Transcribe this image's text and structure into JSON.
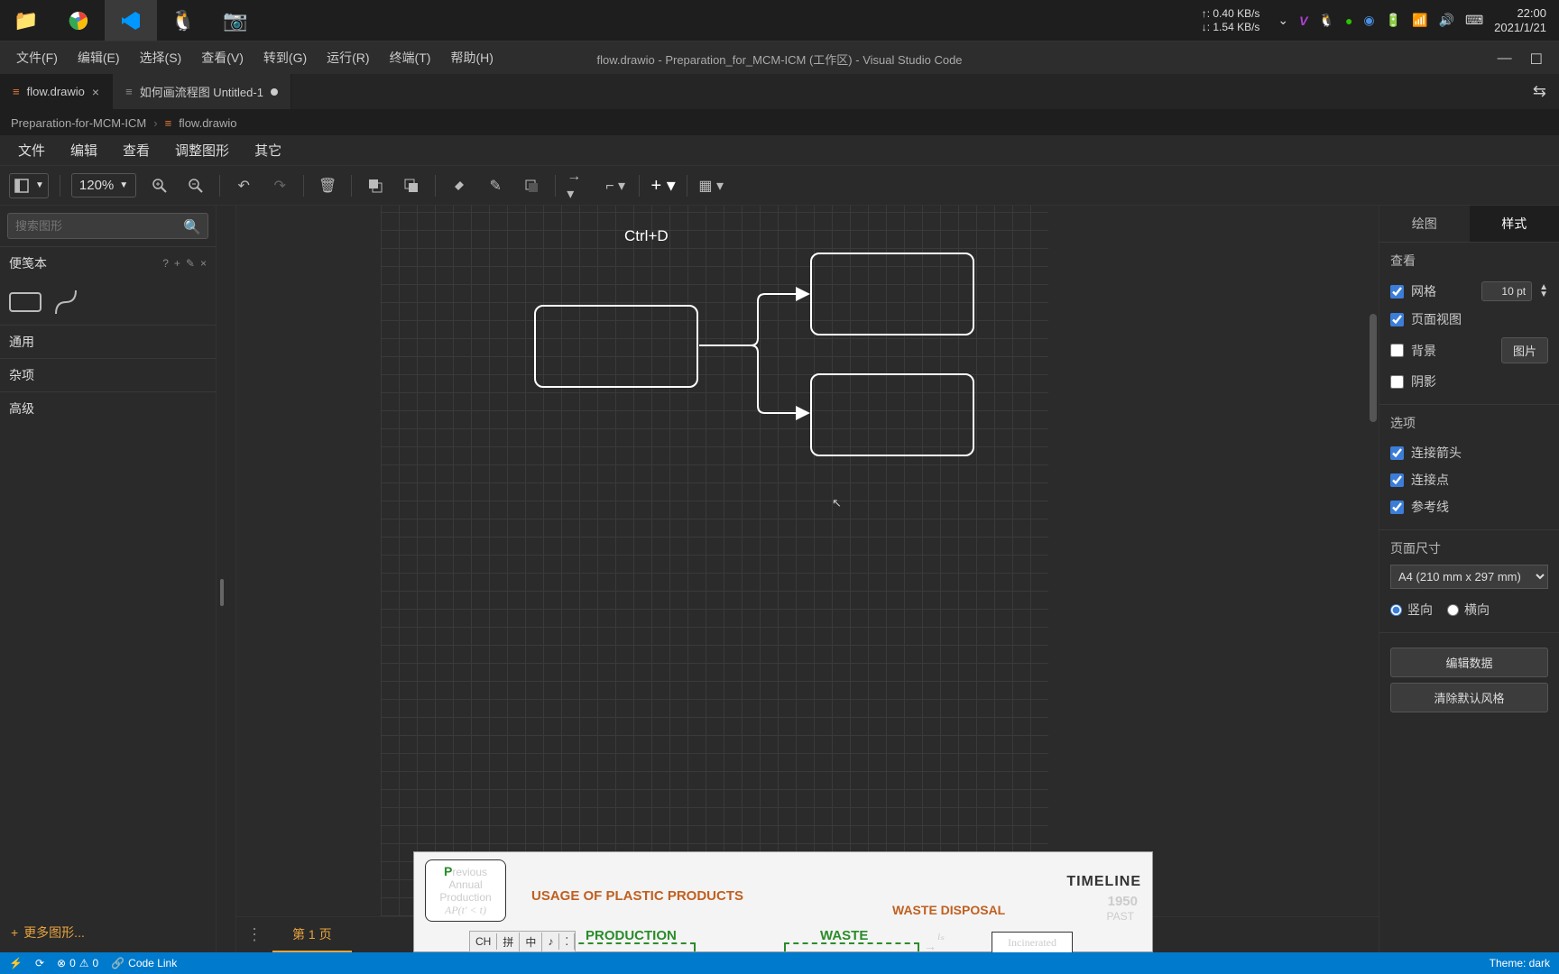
{
  "taskbar": {
    "net_up": "↑: 0.40 KB/s",
    "net_down": "↓: 1.54 KB/s",
    "time": "22:00",
    "date": "2021/1/21"
  },
  "menubar": {
    "items": [
      "文件(F)",
      "编辑(E)",
      "选择(S)",
      "查看(V)",
      "转到(G)",
      "运行(R)",
      "终端(T)",
      "帮助(H)"
    ],
    "title": "flow.drawio - Preparation_for_MCM-ICM (工作区) - Visual Studio Code"
  },
  "tabs": {
    "t1": "flow.drawio",
    "t2": "如何画流程图 Untitled-1"
  },
  "breadcrumb": {
    "p1": "Preparation-for-MCM-ICM",
    "p2": "flow.drawio"
  },
  "drawio_menus": [
    "文件",
    "编辑",
    "查看",
    "调整图形",
    "其它"
  ],
  "toolbar": {
    "zoom": "120%"
  },
  "left": {
    "search_placeholder": "搜索图形",
    "scratchpad": "便笺本",
    "general": "通用",
    "misc": "杂项",
    "advanced": "高级",
    "more": "更多图形..."
  },
  "canvas": {
    "shortcut": "Ctrl+D",
    "page1": "第 1 页"
  },
  "right": {
    "tab_draw": "绘图",
    "tab_style": "样式",
    "section_view": "查看",
    "grid": "网格",
    "grid_value": "10 pt",
    "pageview": "页面视图",
    "background": "背景",
    "image_btn": "图片",
    "shadow": "阴影",
    "section_options": "选项",
    "arrows": "连接箭头",
    "points": "连接点",
    "guides": "参考线",
    "section_pagesize": "页面尺寸",
    "papersize": "A4 (210 mm x 297 mm)",
    "portrait": "竖向",
    "landscape": "横向",
    "editdata": "编辑数据",
    "cleardefault": "清除默认风格"
  },
  "overlay": {
    "prev_annual": "Previous",
    "prev_annual2": "Annual",
    "prev_annual3": "Production",
    "prev_formula": "AP(t' < t)",
    "usage_title": "USAGE OF PLASTIC PRODUCTS",
    "production": "PRODUCTION",
    "waste": "WASTE",
    "waste_disposal": "WASTE DISPOSAL",
    "incinerated": "Incinerated",
    "is_label": "iₛ",
    "timeline": "TIMELINE",
    "year": "1950",
    "past": "PAST"
  },
  "ime": {
    "ch": "CH",
    "pin": "拼",
    "zhong": "中",
    "note": "♪",
    "other": "⁚"
  },
  "statusbar": {
    "errors": "0",
    "warnings": "0",
    "codelink": "Code Link",
    "theme": "Theme: dark"
  }
}
